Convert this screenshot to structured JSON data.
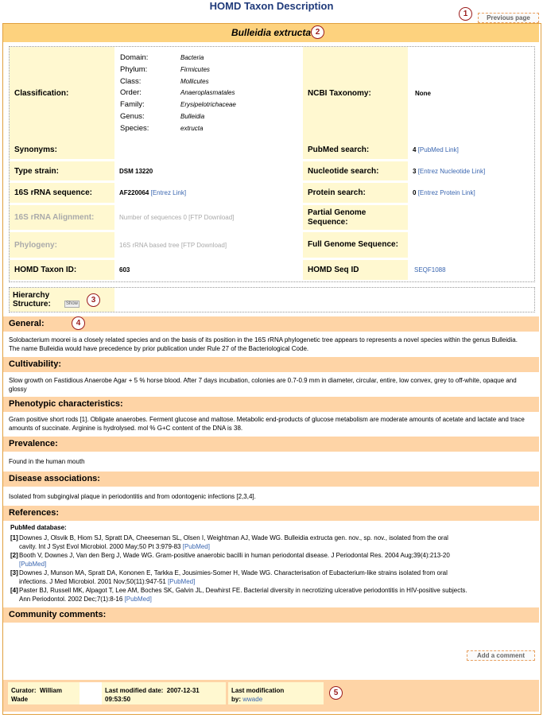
{
  "page": {
    "title": "HOMD Taxon Description"
  },
  "markers": [
    "1",
    "2",
    "3",
    "4",
    "5"
  ],
  "toolbar": {
    "previous_page": "Previous page"
  },
  "taxon": {
    "name": "Bulleidia extructa"
  },
  "classification": {
    "label": "Classification:",
    "ranks": [
      {
        "rank": "Domain:",
        "value": "Bacteria"
      },
      {
        "rank": "Phylum:",
        "value": "Firmicutes"
      },
      {
        "rank": "Class:",
        "value": "Mollicutes"
      },
      {
        "rank": "Order:",
        "value": "Anaeroplasmatales"
      },
      {
        "rank": "Family:",
        "value": "Erysipelotrichaceae"
      },
      {
        "rank": "Genus:",
        "value": "Bulleidia"
      },
      {
        "rank": "Species:",
        "value": "extructa"
      }
    ]
  },
  "ncbi": {
    "label": "NCBI Taxonomy:",
    "value": "None"
  },
  "synonyms": {
    "label": "Synonyms:",
    "value": ""
  },
  "pubmed_search": {
    "label": "PubMed search:",
    "count": "4",
    "link": "[PubMed Link]"
  },
  "type_strain": {
    "label": "Type strain:",
    "value": "DSM 13220"
  },
  "nucleotide_search": {
    "label": "Nucleotide search:",
    "count": "3",
    "link": "[Entrez Nucleotide Link]"
  },
  "rrna_seq": {
    "label": "16S rRNA sequence:",
    "value": "AF220064",
    "link": "[Entrez Link]"
  },
  "protein_search": {
    "label": "Protein search:",
    "count": "0",
    "link": "[Entrez Protein Link]"
  },
  "rrna_align": {
    "label": "16S rRNA Alignment:",
    "value": "Number of sequences 0",
    "link": "[FTP Download]"
  },
  "partial_genome": {
    "label": "Partial Genome Sequence:",
    "value": ""
  },
  "phylogeny": {
    "label": "Phylogeny:",
    "value": "16S rRNA based tree",
    "link": "[FTP Download]"
  },
  "full_genome": {
    "label": "Full Genome Sequence:",
    "value": ""
  },
  "homd_taxon_id": {
    "label": "HOMD Taxon ID:",
    "value": "603"
  },
  "homd_seq_id": {
    "label": "HOMD Seq ID",
    "value": "SEQF1088"
  },
  "hierarchy": {
    "label_1": "Hierarchy",
    "label_2": "Structure:",
    "show": "Show"
  },
  "sections": {
    "general": {
      "heading": "General:",
      "text": "Solobacterium moorei is a closely related species and on the basis of its position in the 16S rRNA phylogenetic tree appears to represents a novel species within the genus Bulleidia. The name Bulleidia would have precedence by prior publication under Rule 27 of the Bacteriological Code."
    },
    "cultivability": {
      "heading": "Cultivability:",
      "text": "Slow growth on Fastidious Anaerobe Agar + 5 % horse blood. After 7 days incubation, colonies are 0.7-0.9 mm in diameter, circular, entire, low convex, grey to off-white, opaque and glossy"
    },
    "phenotypic": {
      "heading": "Phenotypic characteristics:",
      "text": "Gram positive short rods [1]. Obligate anaerobes. Ferment glucose and maltose. Metabolic end-products of glucose metabolism are moderate amounts of acetate and lactate and trace amounts of succinate. Arginine is hydrolysed. mol % G+C content of the DNA is 38."
    },
    "prevalence": {
      "heading": "Prevalence:",
      "text": "Found in the human mouth"
    },
    "disease": {
      "heading": "Disease associations:",
      "text": "Isolated from subgingival plaque in periodontitis and from odontogenic infections [2,3,4]."
    },
    "references": {
      "heading": "References:",
      "subheading": "PubMed database:",
      "items": [
        {
          "num": "[1]",
          "text": "Downes J, Olsvik B, Hiom SJ, Spratt DA, Cheeseman SL, Olsen I, Weightman AJ, Wade WG. Bulleidia extructa gen. nov., sp. nov., isolated from the oral cavity. Int J Syst Evol Microbiol. 2000 May;50 Pt 3:979-83",
          "link": "[PubMed]"
        },
        {
          "num": "[2]",
          "text": "Booth V, Downes J, Van den Berg J, Wade WG. Gram-positive anaerobic bacilli in human periodontal disease. J Periodontal Res. 2004 Aug;39(4):213-20",
          "link": "[PubMed]"
        },
        {
          "num": "[3]",
          "text": "Downes J, Munson MA, Spratt DA, Kononen E, Tarkka E, Jousimies-Somer H, Wade WG. Characterisation of Eubacterium-like strains isolated from oral infections. J Med Microbiol. 2001 Nov;50(11):947-51",
          "link": "[PubMed]"
        },
        {
          "num": "[4]",
          "text": "Paster BJ, Russell MK, Alpagot T, Lee AM, Boches SK, Galvin JL, Dewhirst FE. Bacterial diversity in necrotizing ulcerative periodontitis in HIV-positive subjects. Ann Periodontol. 2002 Dec;7(1):8-16",
          "link": "[PubMed]"
        }
      ]
    },
    "community": {
      "heading": "Community comments:",
      "add_comment": "Add a comment"
    }
  },
  "footer": {
    "curator_label": "Curator:",
    "curator_name": "William",
    "curator_name_2": "Wade",
    "modified_label": "Last modified date:",
    "modified_date": "2007-12-31",
    "modified_time": "09:53:50",
    "last_mod_label": "Last modification",
    "last_mod_by": "by:",
    "last_mod_user": "wwade"
  }
}
